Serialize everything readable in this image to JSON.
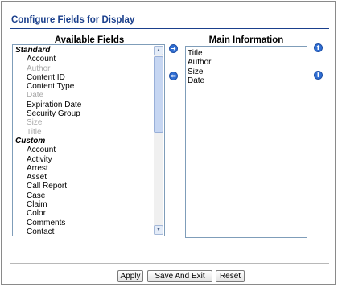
{
  "page": {
    "title": "Configure Fields for Display"
  },
  "available": {
    "heading": "Available Fields",
    "items": [
      {
        "label": "Standard",
        "kind": "group",
        "disabled": false
      },
      {
        "label": "Account",
        "kind": "item",
        "disabled": false
      },
      {
        "label": "Author",
        "kind": "item",
        "disabled": true
      },
      {
        "label": "Content ID",
        "kind": "item",
        "disabled": false
      },
      {
        "label": "Content Type",
        "kind": "item",
        "disabled": false
      },
      {
        "label": "Date",
        "kind": "item",
        "disabled": true
      },
      {
        "label": "Expiration Date",
        "kind": "item",
        "disabled": false
      },
      {
        "label": "Security Group",
        "kind": "item",
        "disabled": false
      },
      {
        "label": "Size",
        "kind": "item",
        "disabled": true
      },
      {
        "label": "Title",
        "kind": "item",
        "disabled": true
      },
      {
        "label": "Custom",
        "kind": "group",
        "disabled": false
      },
      {
        "label": "Account",
        "kind": "item",
        "disabled": false
      },
      {
        "label": "Activity",
        "kind": "item",
        "disabled": false
      },
      {
        "label": "Arrest",
        "kind": "item",
        "disabled": false
      },
      {
        "label": "Asset",
        "kind": "item",
        "disabled": false
      },
      {
        "label": "Call Report",
        "kind": "item",
        "disabled": false
      },
      {
        "label": "Case",
        "kind": "item",
        "disabled": false
      },
      {
        "label": "Claim",
        "kind": "item",
        "disabled": false
      },
      {
        "label": "Color",
        "kind": "item",
        "disabled": false
      },
      {
        "label": "Comments",
        "kind": "item",
        "disabled": false
      },
      {
        "label": "Contact",
        "kind": "item",
        "disabled": false
      }
    ]
  },
  "main": {
    "heading": "Main Information",
    "items": [
      "Title",
      "Author",
      "Size",
      "Date"
    ]
  },
  "buttons": {
    "apply": "Apply",
    "save_exit": "Save And Exit",
    "reset": "Reset"
  },
  "icons": {
    "add": "arrow-right-icon",
    "remove": "arrow-left-icon",
    "move_up": "arrow-up-icon",
    "move_down": "arrow-down-icon"
  },
  "colors": {
    "accent": "#1a3f8c",
    "arrow_button": "#2f6ed3",
    "disabled_text": "#a8a8a8"
  }
}
